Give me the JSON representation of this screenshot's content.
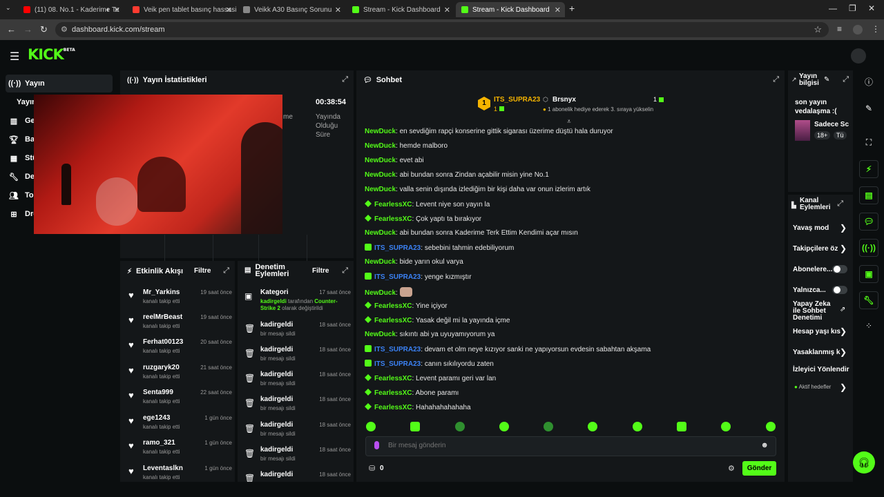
{
  "browser": {
    "tabs": [
      {
        "label": "(11) 08. No.1 - Kaderime Te",
        "favicon_color": "#ff0000"
      },
      {
        "label": "Veik pen tablet basınç hassasiye",
        "favicon_color": "#ff3b30"
      },
      {
        "label": "Veikk A30 Basınç Sorunu",
        "favicon_color": "#888888"
      },
      {
        "label": "Stream - Kick Dashboard",
        "favicon_color": "#53fc18"
      },
      {
        "label": "Stream - Kick Dashboard",
        "favicon_color": "#53fc18"
      }
    ],
    "url": "dashboard.kick.com/stream"
  },
  "header": {
    "logo": "KICK",
    "logo_sup": "BETA"
  },
  "sidebar": {
    "items": [
      {
        "label": "Yayın",
        "icon": "broadcast-icon"
      },
      {
        "label": "Yayın",
        "icon": ""
      },
      {
        "label": "Ge",
        "icon": "chart-icon"
      },
      {
        "label": "Ba",
        "icon": "trophy-icon"
      },
      {
        "label": "Stü",
        "icon": "grid-icon"
      },
      {
        "label": "De",
        "icon": "wrench-icon"
      },
      {
        "label": "To",
        "icon": "users-icon"
      },
      {
        "label": "Dro",
        "icon": "gift-icon"
      }
    ]
  },
  "stats": {
    "title": "Yayın İstatistikleri",
    "partial": "me",
    "time": "00:38:54",
    "time_label": "Yayında Olduğu Süre"
  },
  "activity": {
    "title": "Etkinlik Akışı",
    "filter": "Filtre",
    "items": [
      {
        "name": "Mr_Yarkins",
        "sub": "kanalı takip etti",
        "time": "19 saat önce"
      },
      {
        "name": "reelMrBeast",
        "sub": "kanalı takip etti",
        "time": "19 saat önce"
      },
      {
        "name": "Ferhat00123",
        "sub": "kanalı takip etti",
        "time": "20 saat önce"
      },
      {
        "name": "ruzgaryk20",
        "sub": "kanalı takip etti",
        "time": "21 saat önce"
      },
      {
        "name": "Senta999",
        "sub": "kanalı takip etti",
        "time": "22 saat önce"
      },
      {
        "name": "ege1243",
        "sub": "kanalı takip etti",
        "time": "1 gün önce"
      },
      {
        "name": "ramo_321",
        "sub": "kanalı takip etti",
        "time": "1 gün önce"
      },
      {
        "name": "Leventaslkn",
        "sub": "kanalı takip etti",
        "time": "1 gün önce"
      }
    ]
  },
  "moderation": {
    "title": "Denetim Eylemleri",
    "filter": "Filtre",
    "category": {
      "name": "Kategori",
      "time": "17 saat önce",
      "user": "kadirgeldi",
      "mid": " tarafından ",
      "game": "Counter-Strike 2",
      "tail": " olarak değiştirildi"
    },
    "items": [
      {
        "name": "kadirgeldi",
        "sub": "bir mesajı sildi",
        "time": "18 saat önce"
      },
      {
        "name": "kadirgeldi",
        "sub": "bir mesajı sildi",
        "time": "18 saat önce"
      },
      {
        "name": "kadirgeldi",
        "sub": "bir mesajı sildi",
        "time": "18 saat önce"
      },
      {
        "name": "kadirgeldi",
        "sub": "bir mesajı sildi",
        "time": "18 saat önce"
      },
      {
        "name": "kadirgeldi",
        "sub": "bir mesajı sildi",
        "time": "18 saat önce"
      },
      {
        "name": "kadirgeldi",
        "sub": "bir mesajı sildi",
        "time": "18 saat önce"
      },
      {
        "name": "kadirgeldi",
        "sub": "",
        "time": "18 saat önce"
      }
    ]
  },
  "chat": {
    "title": "Sohbet",
    "pinned": {
      "rank": "1",
      "user": "ITS_SUPRA23",
      "user_count": "1",
      "gifter": "Brsnyx",
      "gifter_count": "1",
      "note": "1 abonelik hediye ederek 3. sıraya yükselin"
    },
    "messages": [
      {
        "user": "NewDuck",
        "text": "en sevdiğim rapçi konserine gittik sigarası üzerime düştü hala duruyor",
        "color": "#53fc18",
        "badge": ""
      },
      {
        "user": "NewDuck",
        "text": "hemde malboro",
        "color": "#53fc18",
        "badge": ""
      },
      {
        "user": "NewDuck",
        "text": "evet abi",
        "color": "#53fc18",
        "badge": ""
      },
      {
        "user": "NewDuck",
        "text": "abi bundan sonra Zindan açabilir misin yine No.1",
        "color": "#53fc18",
        "badge": ""
      },
      {
        "user": "NewDuck",
        "text": "valla senin dışında izlediğim bir kişi daha var onun izlerim artık",
        "color": "#53fc18",
        "badge": ""
      },
      {
        "user": "FearlessXC",
        "text": "Levent niye son yayın la",
        "color": "#53fc18",
        "badge": "diamond"
      },
      {
        "user": "FearlessXC",
        "text": "Çok yaptı ta bırakıyor",
        "color": "#53fc18",
        "badge": "diamond"
      },
      {
        "user": "NewDuck",
        "text": "abi bundan sonra Kaderime Terk Ettim Kendimi açar mısın",
        "color": "#53fc18",
        "badge": ""
      },
      {
        "user": "ITS_SUPRA23",
        "text": "sebebini tahmin edebiliyorum",
        "color": "#3b82f6",
        "badge": "gift"
      },
      {
        "user": "NewDuck",
        "text": "bide yarın okul varya",
        "color": "#53fc18",
        "badge": ""
      },
      {
        "user": "ITS_SUPRA23",
        "text": "yenge kızmıştır",
        "color": "#3b82f6",
        "badge": "gift"
      },
      {
        "user": "NewDuck",
        "text": "",
        "color": "#53fc18",
        "badge": "",
        "emote": true
      },
      {
        "user": "FearlessXC",
        "text": "Yine içiyor",
        "color": "#53fc18",
        "badge": "diamond"
      },
      {
        "user": "FearlessXC",
        "text": "Yasak değil mi la yayında içme",
        "color": "#53fc18",
        "badge": "diamond"
      },
      {
        "user": "NewDuck",
        "text": "sıkıntı abi ya uyuyamıyorum ya",
        "color": "#53fc18",
        "badge": ""
      },
      {
        "user": "ITS_SUPRA23",
        "text": "devam et olm neye kızıyor sanki ne yapıyorsun evdesin sabahtan akşama",
        "color": "#3b82f6",
        "badge": "gift"
      },
      {
        "user": "ITS_SUPRA23",
        "text": "canın sıkılıyordu zaten",
        "color": "#3b82f6",
        "badge": "gift"
      },
      {
        "user": "FearlessXC",
        "text": "Levent paramı geri var lan",
        "color": "#53fc18",
        "badge": "diamond"
      },
      {
        "user": "FearlessXC",
        "text": "Abone paramı",
        "color": "#53fc18",
        "badge": "diamond"
      },
      {
        "user": "FearlessXC",
        "text": "Hahahahahahaha",
        "color": "#53fc18",
        "badge": "diamond"
      }
    ],
    "input_placeholder": "Bir mesaj gönderin",
    "points": "0",
    "send_label": "Gönder"
  },
  "stream_info": {
    "title": "Yayın bilgisi",
    "stream_title": "son yayın vedalaşma :(",
    "category": "Sadece Sc",
    "tag_age": "18+",
    "tag_t": "Tü"
  },
  "channel_actions": {
    "title": "Kanal Eylemleri",
    "items": [
      {
        "label": "Yavaş mod",
        "control": "chevron"
      },
      {
        "label": "Takipçilere öz",
        "control": "chevron"
      },
      {
        "label": "Abonelere...",
        "control": "toggle"
      },
      {
        "label": "Yalnızca...",
        "control": "toggle"
      },
      {
        "label": "Yapay Zeka ile Sohbet Denetimi",
        "control": "link"
      },
      {
        "label": "Hesap yaşı kıs",
        "control": "chevron"
      },
      {
        "label": "Yasaklanmış k",
        "control": "chevron"
      },
      {
        "label": "İzleyici Yönlendir",
        "control": "none"
      }
    ],
    "active_targets": "Aktif hedefler"
  }
}
